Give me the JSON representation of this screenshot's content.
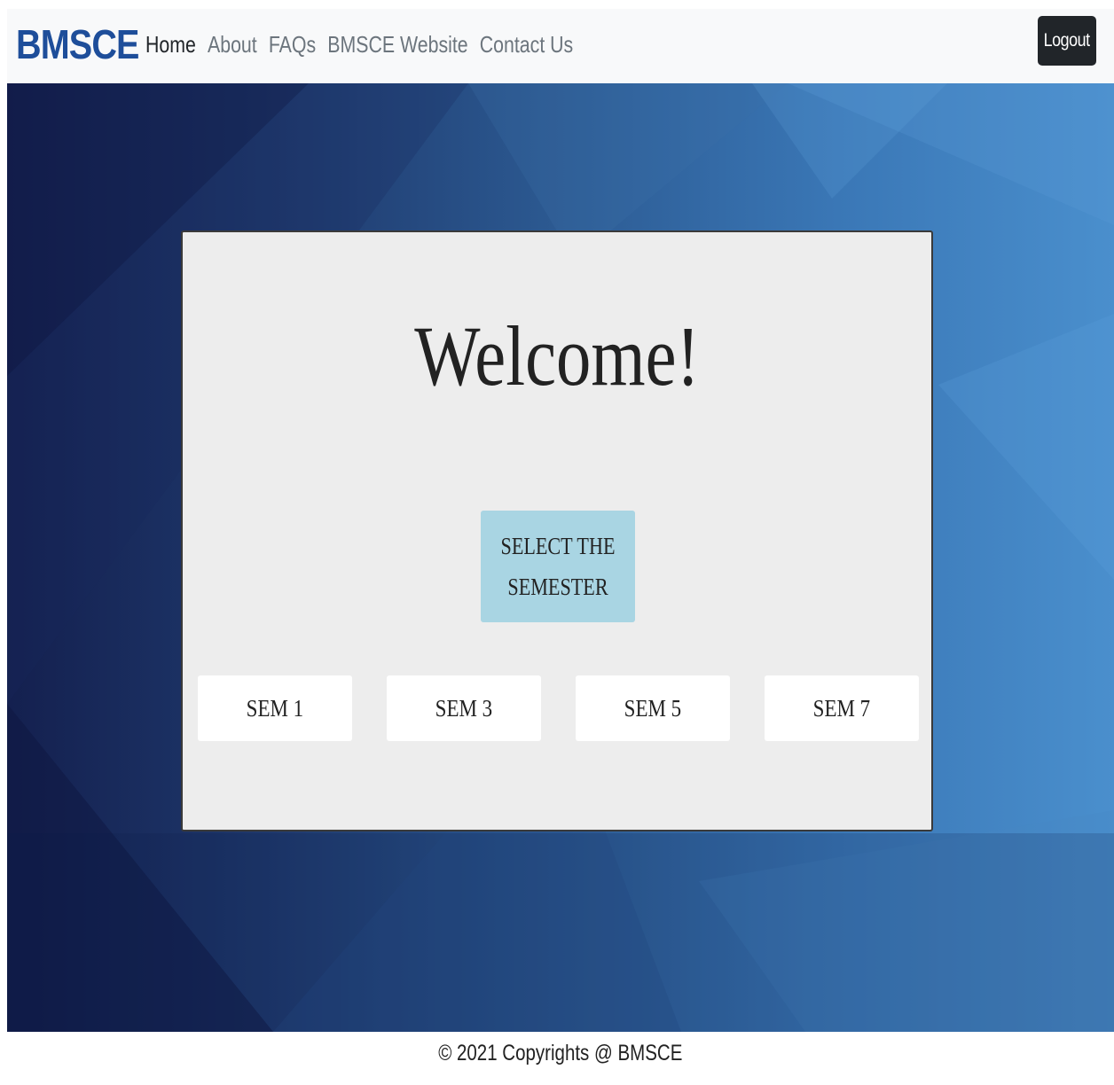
{
  "navbar": {
    "brand": "BMSCE",
    "links": [
      {
        "label": "Home",
        "active": true
      },
      {
        "label": "About",
        "active": false
      },
      {
        "label": "FAQs",
        "active": false
      },
      {
        "label": "BMSCE Website",
        "active": false
      },
      {
        "label": "Contact Us",
        "active": false
      }
    ],
    "logout_label": "Logout"
  },
  "main": {
    "heading": "Welcome!",
    "select_label": "SELECT THE SEMESTER",
    "semesters": [
      {
        "label": "SEM 1"
      },
      {
        "label": "SEM 3"
      },
      {
        "label": "SEM 5"
      },
      {
        "label": "SEM 7"
      }
    ]
  },
  "footer": {
    "text": "© 2021 Copyrights @ BMSCE"
  },
  "colors": {
    "brand": "#1e4e9a",
    "navbar_bg": "#f8f9fa",
    "logout_bg": "#212529",
    "card_bg": "#ededed",
    "select_bg": "#a9d5e3",
    "hero_gradient_start": "#14204f",
    "hero_gradient_end": "#4a8fcd"
  }
}
